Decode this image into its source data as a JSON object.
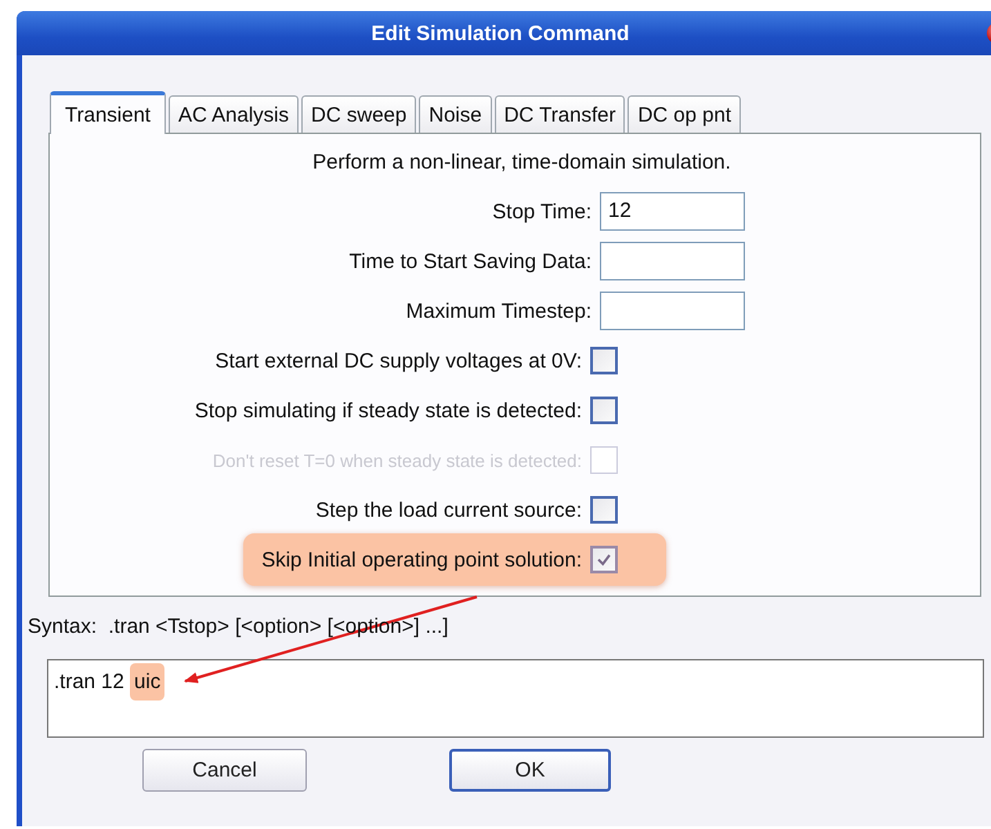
{
  "window": {
    "title": "Edit Simulation Command"
  },
  "tabs": [
    {
      "label": "Transient",
      "selected": true
    },
    {
      "label": "AC Analysis",
      "selected": false
    },
    {
      "label": "DC sweep",
      "selected": false
    },
    {
      "label": "Noise",
      "selected": false
    },
    {
      "label": "DC Transfer",
      "selected": false
    },
    {
      "label": "DC op pnt",
      "selected": false
    }
  ],
  "description": "Perform a non-linear, time-domain simulation.",
  "rows": [
    {
      "kind": "field",
      "label": "Stop Time:",
      "value": "12"
    },
    {
      "kind": "field",
      "label": "Time to Start Saving Data:"
    },
    {
      "kind": "field",
      "label": "Maximum Timestep:"
    },
    {
      "kind": "checkbox",
      "label": "Start external DC supply voltages at 0V:",
      "checked": false,
      "disabled": false,
      "highlighted": false
    },
    {
      "kind": "checkbox",
      "label": "Stop simulating if steady state is detected:",
      "checked": false,
      "disabled": false,
      "highlighted": false
    },
    {
      "kind": "checkbox",
      "label": "Don't reset T=0 when steady state is detected:",
      "checked": false,
      "disabled": true,
      "highlighted": false
    },
    {
      "kind": "checkbox",
      "label": "Step the load current source:",
      "checked": false,
      "disabled": false,
      "highlighted": false
    },
    {
      "kind": "checkbox",
      "label": "Skip Initial operating point solution:",
      "checked": true,
      "disabled": false,
      "highlighted": true
    }
  ],
  "syntax": "Syntax:  .tran <Tstop> [<option> [<option>] ...]",
  "command": {
    "value": ".tran 12",
    "highlighted_part": "uic"
  },
  "buttons": [
    {
      "label": "Cancel",
      "default": false
    },
    {
      "label": "OK",
      "default": true
    }
  ]
}
